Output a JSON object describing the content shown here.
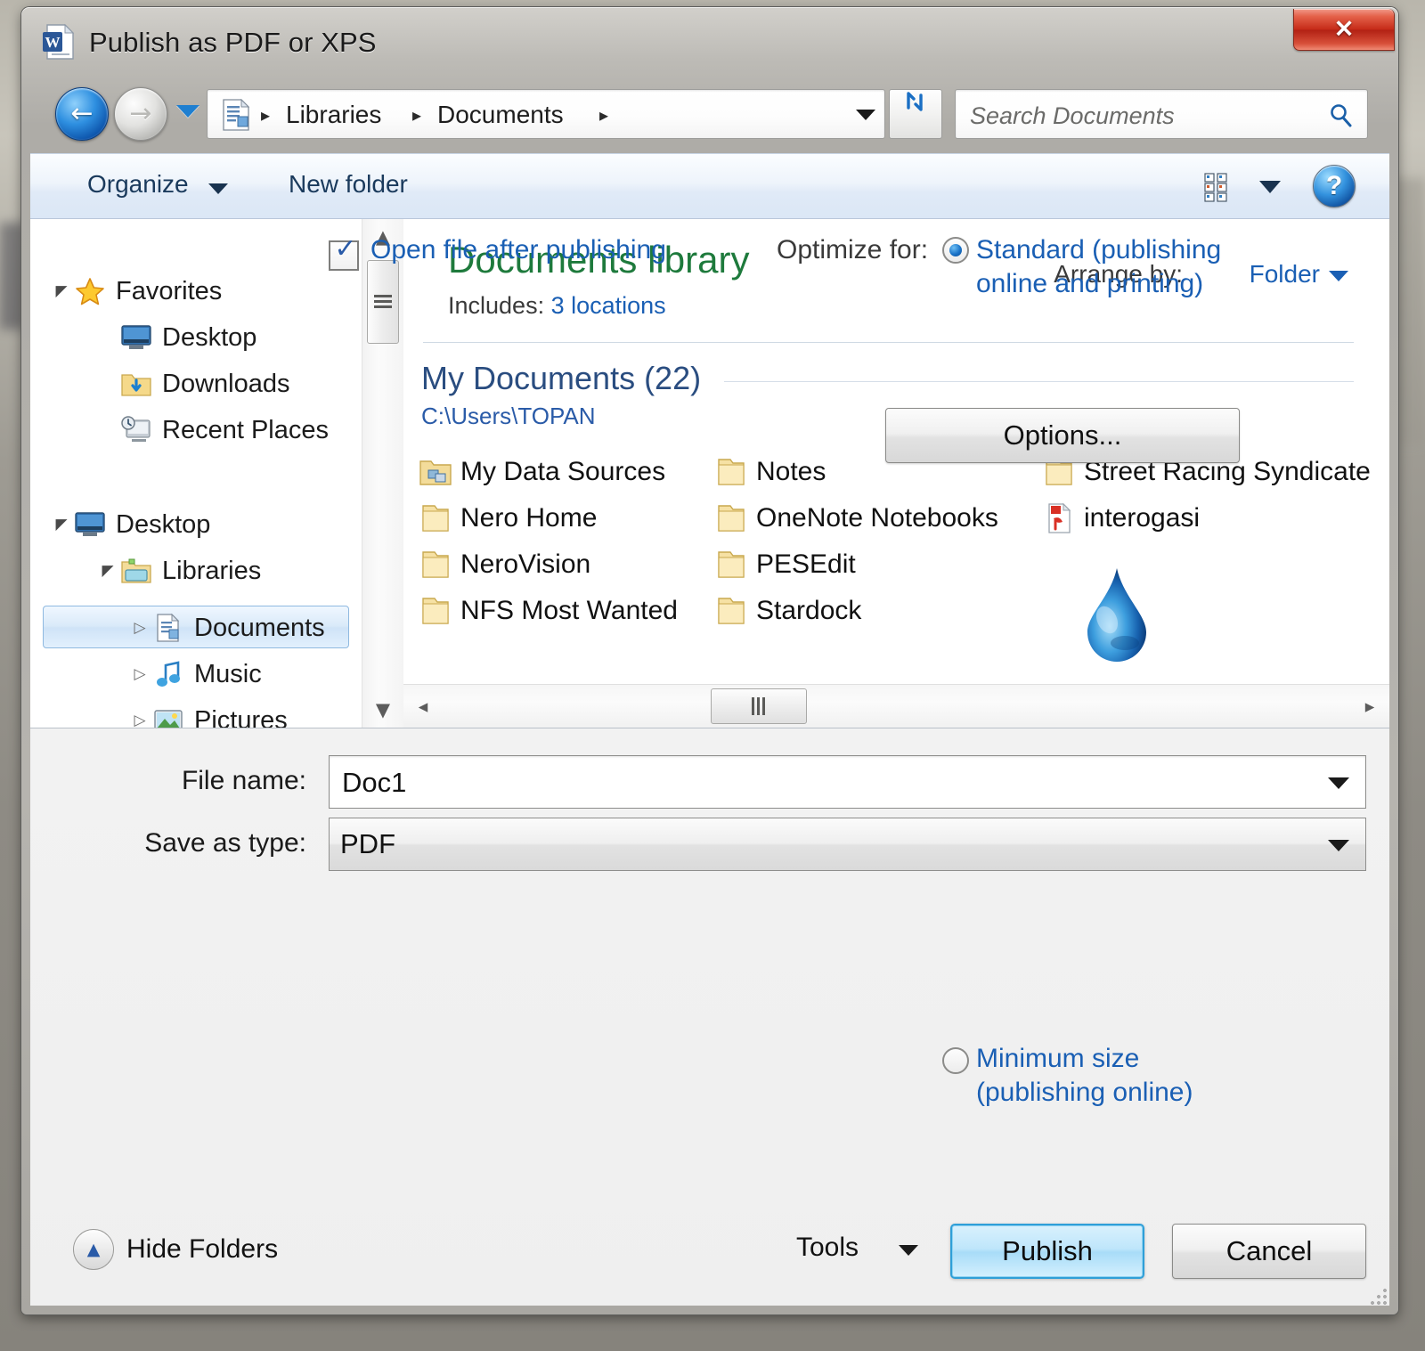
{
  "window": {
    "title": "Publish as PDF or XPS",
    "app_icon": "word-document-icon",
    "close_label": "✕"
  },
  "navigation": {
    "back_icon": "back-arrow-icon",
    "forward_icon": "forward-arrow-icon",
    "history_icon": "chevron-down-icon",
    "breadcrumb_icon": "library-document-icon",
    "breadcrumbs": [
      "Libraries",
      "Documents"
    ],
    "separator": "▸",
    "refresh_icon": "refresh-icon",
    "refresh_glyph": "↺",
    "address_dropdown_icon": "chevron-down-icon"
  },
  "search": {
    "placeholder": "Search Documents",
    "value": "",
    "icon": "search-magnifier-icon"
  },
  "command_bar": {
    "organize_label": "Organize",
    "organize_caret_icon": "chevron-down-icon",
    "new_folder_label": "New folder",
    "view_mode_icon": "view-details-icon",
    "view_mode_caret_icon": "chevron-down-icon",
    "help_icon": "help-question-icon",
    "help_glyph": "?"
  },
  "sidebar": {
    "scroll_up_icon": "▲",
    "scroll_down_icon": "▼",
    "items": [
      {
        "label": "Favorites",
        "icon": "star-icon",
        "indent": 0,
        "expander": "open",
        "selected": false
      },
      {
        "label": "Desktop",
        "icon": "desktop-icon",
        "indent": 1,
        "expander": "none",
        "selected": false
      },
      {
        "label": "Downloads",
        "icon": "downloads-icon",
        "indent": 1,
        "expander": "none",
        "selected": false
      },
      {
        "label": "Recent Places",
        "icon": "recent-places-icon",
        "indent": 1,
        "expander": "none",
        "selected": false
      },
      {
        "label": "Desktop",
        "icon": "desktop-icon",
        "indent": 0,
        "expander": "open",
        "selected": false
      },
      {
        "label": "Libraries",
        "icon": "libraries-icon",
        "indent": 1,
        "expander": "open",
        "selected": false
      },
      {
        "label": "Documents",
        "icon": "documents-icon",
        "indent": 2,
        "expander": "closed",
        "selected": true
      },
      {
        "label": "Music",
        "icon": "music-icon",
        "indent": 2,
        "expander": "closed",
        "selected": false
      },
      {
        "label": "Pictures",
        "icon": "pictures-icon",
        "indent": 2,
        "expander": "closed",
        "selected": false
      }
    ]
  },
  "file_pane": {
    "library_title": "Documents library",
    "includes_label": "Includes:",
    "includes_link": "3 locations",
    "arrange_label": "Arrange by:",
    "arrange_value": "Folder",
    "arrange_caret_icon": "chevron-down-icon",
    "group_title": "My Documents (22)",
    "group_path": "C:\\Users\\TOPAN",
    "columns": [
      [
        {
          "label": "My Data Sources",
          "icon": "data-sources-folder-icon"
        },
        {
          "label": "Nero Home",
          "icon": "folder-icon"
        },
        {
          "label": "NeroVision",
          "icon": "folder-icon"
        },
        {
          "label": "NFS Most Wanted",
          "icon": "folder-icon"
        }
      ],
      [
        {
          "label": "Notes",
          "icon": "folder-icon"
        },
        {
          "label": "OneNote Notebooks",
          "icon": "folder-icon"
        },
        {
          "label": "PESEdit",
          "icon": "folder-icon"
        },
        {
          "label": "Stardock",
          "icon": "folder-icon"
        }
      ],
      [
        {
          "label": "Street Racing Syndicate",
          "icon": "folder-icon"
        },
        {
          "label": "interogasi",
          "icon": "pdf-file-icon"
        }
      ]
    ],
    "hscroll_left_icon": "◂",
    "hscroll_right_icon": "▸",
    "cursor_icon": "water-droplet-icon"
  },
  "form": {
    "filename_label": "File name:",
    "filename_value": "Doc1",
    "filename_caret_icon": "chevron-down-icon",
    "savetype_label": "Save as type:",
    "savetype_value": "PDF",
    "savetype_caret_icon": "chevron-down-icon",
    "open_after_label": "Open file after publishing",
    "open_after_checked": true,
    "check_glyph": "✓",
    "optimize_label": "Optimize for:",
    "optimize_options": [
      {
        "label": "Standard (publishing online and printing)",
        "selected": true
      },
      {
        "label": "Minimum size (publishing online)",
        "selected": false
      }
    ],
    "options_button": "Options..."
  },
  "footer": {
    "hide_folders_label": "Hide Folders",
    "hide_folders_icon": "▲",
    "tools_label": "Tools",
    "tools_caret_icon": "chevron-down-icon",
    "publish_label": "Publish",
    "cancel_label": "Cancel"
  },
  "colors": {
    "library_green": "#1e7a3c",
    "link_blue": "#1a5fb4",
    "group_blue": "#2a4d80",
    "accent_blue": "#2f9fd8",
    "close_red": "#c62b18"
  }
}
